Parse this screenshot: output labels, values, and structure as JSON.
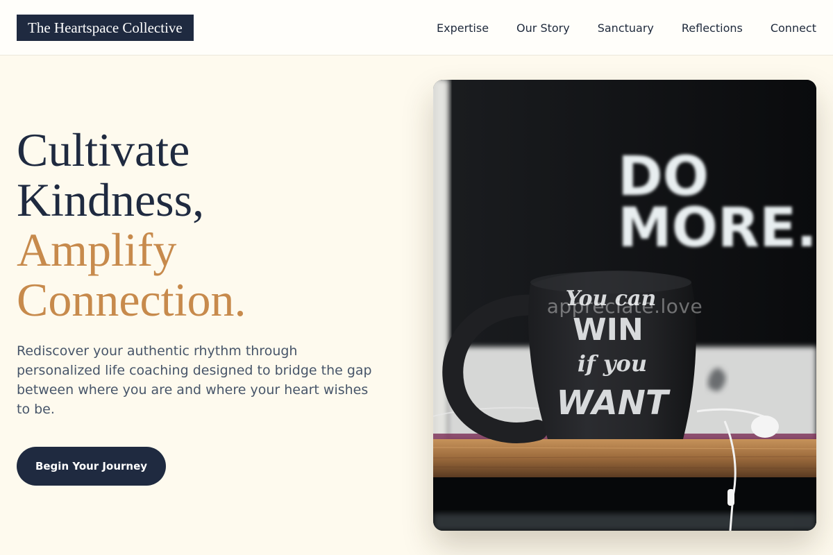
{
  "brand": {
    "name": "The Heartspace Collective"
  },
  "nav": {
    "items": [
      {
        "label": "Expertise"
      },
      {
        "label": "Our Story"
      },
      {
        "label": "Sanctuary"
      },
      {
        "label": "Reflections"
      },
      {
        "label": "Connect"
      }
    ]
  },
  "hero": {
    "title_line_1": "Cultivate",
    "title_line_2": "Kindness,",
    "title_line_3": "Amplify",
    "title_line_4": "Connection.",
    "description": "Rediscover your authentic rhythm through personalized life coaching designed to bridge the gap between where you are and where your heart wishes to be.",
    "cta_label": "Begin Your Journey"
  },
  "image": {
    "sign_line_1": "DO",
    "sign_line_2": "MORE.",
    "mug_line_1": "You can",
    "mug_line_2": "WIN",
    "mug_line_3": "if you",
    "mug_line_4": "WANT",
    "watermark": "appreciate.love"
  },
  "colors": {
    "navy": "#1f2a40",
    "accent": "#c78a4c",
    "background": "#fefaee"
  }
}
